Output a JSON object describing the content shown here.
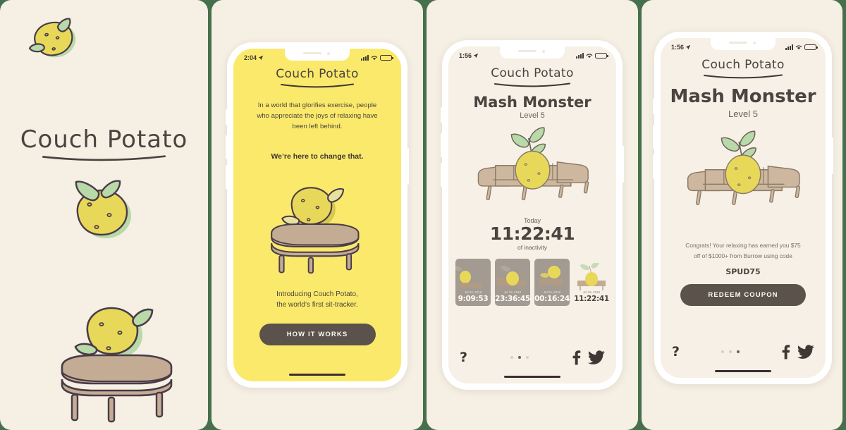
{
  "theme": {
    "page_bg": "#46704b",
    "card_bg": "#f5efe4",
    "screen_yellow": "#fbe96b",
    "screen_cream": "#f6f0e6",
    "ink": "#4a4440",
    "button_bg": "#5b524c",
    "potato_yellow": "#e8d85a",
    "leaf_green": "#b8d9a8",
    "couch_tan": "#c3ac93"
  },
  "brand": {
    "name": "Couch Potato"
  },
  "hero": {
    "title": "Couch Potato",
    "potato_icon": "potato-icon",
    "sprout_icon": "sprouting-potato-icon",
    "ottoman_icon": "potato-on-ottoman-icon"
  },
  "onboarding": {
    "status": {
      "time": "2:04",
      "location_icon": "location-arrow-icon",
      "signal_icon": "cellular-bars-icon",
      "wifi_icon": "wifi-icon",
      "battery_icon": "battery-icon"
    },
    "logo": "Couch Potato",
    "paragraph": "In a world that glorifies exercise, people who appreciate the joys of relaxing have been left behind.",
    "tagline": "We’re here to change that.",
    "illustration": "potato-on-ottoman-icon",
    "subtext": "Introducing Couch Potato,\nthe world’s first sit-tracker.",
    "subtext_line1": "Introducing Couch Potato,",
    "subtext_line2": "the world’s first sit-tracker.",
    "cta_label": "HOW IT WORKS"
  },
  "tracker": {
    "status": {
      "time": "1:56",
      "location_icon": "location-arrow-icon",
      "signal_icon": "cellular-bars-icon",
      "wifi_icon": "wifi-icon",
      "battery_icon": "battery-icon"
    },
    "logo": "Couch Potato",
    "title": "Mash Monster",
    "level": "Level 5",
    "illustration": "sprout-potato-on-couch-icon",
    "today_label": "Today",
    "today_time": "11:22:41",
    "today_sub": "of inactivity",
    "history": [
      {
        "date": "Jul 22, 2018",
        "time": "9:09:53",
        "current": false
      },
      {
        "date": "Jul 23, 2018",
        "time": "23:36:45",
        "current": false
      },
      {
        "date": "Jul 24, 2018",
        "time": "00:16:24",
        "current": false
      },
      {
        "date": "Jul 25, 2018",
        "time": "11:22:41",
        "current": true
      }
    ],
    "help_label": "?",
    "page_dots": 3,
    "active_dot": 1,
    "facebook_icon": "facebook-icon",
    "twitter_icon": "twitter-icon"
  },
  "reward": {
    "status": {
      "time": "1:56",
      "location_icon": "location-arrow-icon",
      "signal_icon": "cellular-bars-icon",
      "wifi_icon": "wifi-icon",
      "battery_icon": "battery-icon"
    },
    "logo": "Couch Potato",
    "title": "Mash Monster",
    "level": "Level 5",
    "illustration": "sprout-potato-on-couch-icon",
    "message_line1": "Congrats! Your relaxing has earned you $75",
    "message_line2": "off of $1000+ from Burrow using code",
    "code": "SPUD75",
    "cta_label": "REDEEM COUPON",
    "help_label": "?",
    "page_dots": 3,
    "active_dot": 2,
    "facebook_icon": "facebook-icon",
    "twitter_icon": "twitter-icon"
  }
}
